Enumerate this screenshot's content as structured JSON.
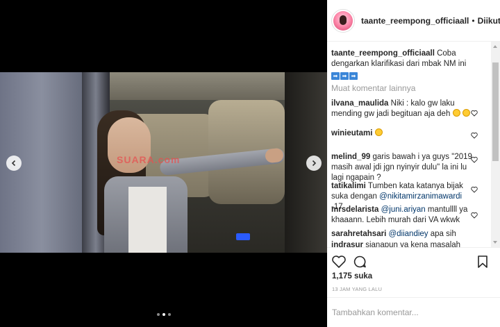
{
  "post": {
    "username": "taante_reempong_officiaall",
    "follow_separator": "•",
    "follow_status": "Diikuti",
    "caption": {
      "user": "taante_reempong_officiaall",
      "text": "Coba dengarkan klarifikasi dari mbak NM ini"
    },
    "load_more": "Muat komentar lainnya",
    "likes": "1,175 suka",
    "timestamp": "13 JAM YANG LALU",
    "comment_placeholder": "Tambahkan komentar...",
    "media": {
      "watermark": "SUARA.com",
      "carousel_dots": 3,
      "active_dot": 2
    }
  },
  "comments": [
    {
      "user": "ilvana_maulida",
      "text": "Niki : kalo gw laku mending gw jadi begituan aja deh"
    },
    {
      "user": "winieutami",
      "text": ""
    },
    {
      "user": "melind_99",
      "text": "garis bawah i ya guys \"2019 masih awal jdi jgn nyinyir dulu\" la ini lu lagi ngapain ?"
    },
    {
      "user": "tatikalimi",
      "text": "Tumben kata katanya bijak suka dengan",
      "mention": "@nikitamirzanimawardi",
      "after": "-17"
    },
    {
      "user": "mrsdelarista",
      "text": "",
      "mention": "@juni.ariyan",
      "after": "mantullll ya khaaann. Lebih murah dari VA wkwk"
    },
    {
      "user": "sarahretahsari",
      "text": "",
      "mention": "@diiandiey",
      "after": "apa sih"
    },
    {
      "user": "indrasur",
      "text": "sianapun ya kena masalah"
    }
  ],
  "colors": {
    "text": "#262626",
    "muted": "#999999",
    "mention": "#003569",
    "border": "#efefef"
  }
}
